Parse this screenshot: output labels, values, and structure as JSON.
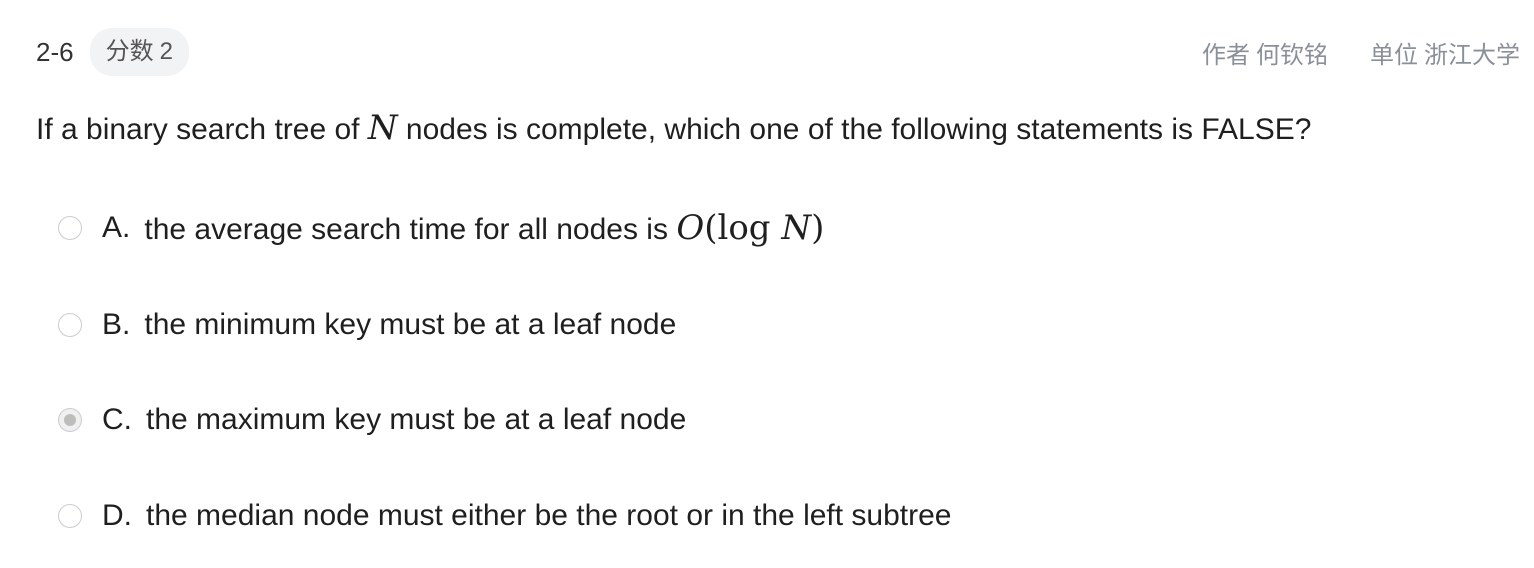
{
  "header": {
    "question_number": "2-6",
    "score_label": "分数",
    "score_value": "2",
    "author_label": "作者",
    "author_name": "何钦铭",
    "unit_label": "单位",
    "unit_name": "浙江大学"
  },
  "question": {
    "text_before": "If a binary search tree of ",
    "math_var": "N",
    "text_after": " nodes is complete, which one of the following statements is FALSE?"
  },
  "options": [
    {
      "letter": "A.",
      "text": "the average search time for all nodes is ",
      "math_O": "O",
      "math_open": "(",
      "math_log": "log",
      "math_N": "N",
      "math_close": ")",
      "selected": false
    },
    {
      "letter": "B.",
      "text": "the minimum key must be at a leaf node",
      "selected": false
    },
    {
      "letter": "C.",
      "text": "the maximum key must be at a leaf node",
      "selected": true
    },
    {
      "letter": "D.",
      "text": "the median node must either be the root or in the left subtree",
      "selected": false
    }
  ]
}
